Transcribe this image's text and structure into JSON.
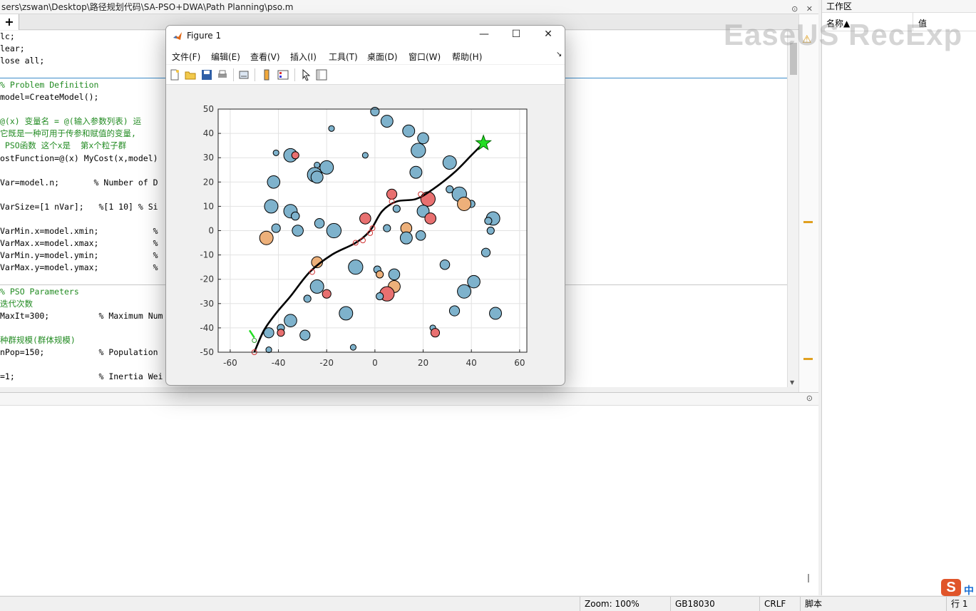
{
  "editor": {
    "path": "sers\\zswan\\Desktop\\路径规划代码\\SA-PSO+DWA\\Path Planning\\pso.m",
    "tab_plus": "+",
    "lines": [
      {
        "text": "lc;",
        "cls": ""
      },
      {
        "text": "lear;",
        "cls": ""
      },
      {
        "text": "lose all;",
        "cls": ""
      },
      {
        "text": "",
        "cls": ""
      },
      {
        "text": "% Problem Definition",
        "cls": "comment"
      },
      {
        "text": "model=CreateModel();",
        "cls": ""
      },
      {
        "text": "",
        "cls": ""
      },
      {
        "text": "@(x) 变量名 = @(输入参数列表) 运",
        "cls": "comment"
      },
      {
        "text": "它既是一种可用于传参和赋值的变量,",
        "cls": "comment"
      },
      {
        "text": " PSO函数 这个x是  第x个粒子群",
        "cls": "comment"
      },
      {
        "text": "ostFunction=@(x) MyCost(x,model)",
        "cls": ""
      },
      {
        "text": "",
        "cls": ""
      },
      {
        "text": "Var=model.n;       % Number of D",
        "cls": ""
      },
      {
        "text": "",
        "cls": ""
      },
      {
        "text": "VarSize=[1 nVar];   %[1 10] % Si",
        "cls": ""
      },
      {
        "text": "",
        "cls": ""
      },
      {
        "text": "VarMin.x=model.xmin;           %",
        "cls": ""
      },
      {
        "text": "VarMax.x=model.xmax;           %",
        "cls": ""
      },
      {
        "text": "VarMin.y=model.ymin;           %",
        "cls": ""
      },
      {
        "text": "VarMax.y=model.ymax;           %",
        "cls": ""
      },
      {
        "text": "",
        "cls": ""
      },
      {
        "text": "% PSO Parameters",
        "cls": "comment"
      },
      {
        "text": "迭代次数",
        "cls": "comment"
      },
      {
        "text": "MaxIt=300;          % Maximum Num",
        "cls": ""
      },
      {
        "text": "",
        "cls": ""
      },
      {
        "text": "种群规模(群体规模)",
        "cls": "comment"
      },
      {
        "text": "nPop=150;           % Population",
        "cls": ""
      },
      {
        "text": "",
        "cls": ""
      },
      {
        "text": "=1;                 % Inertia Wei",
        "cls": ""
      }
    ]
  },
  "workspace": {
    "title": "工作区",
    "col_name": "名称▲",
    "col_value": "值"
  },
  "watermark": "EaseUS RecExp",
  "statusbar": {
    "zoom": "Zoom: 100%",
    "encoding": "GB18030",
    "eol": "CRLF",
    "type": "脚本",
    "pos": "行  1"
  },
  "ime": {
    "logo": "S",
    "lang": "中"
  },
  "figure": {
    "title": "Figure 1",
    "menus": [
      "文件(F)",
      "编辑(E)",
      "查看(V)",
      "插入(I)",
      "工具(T)",
      "桌面(D)",
      "窗口(W)",
      "帮助(H)"
    ],
    "menu_arrow": "↘",
    "controls": {
      "minimize": "—",
      "maximize": "☐",
      "close": "✕"
    }
  },
  "chart_data": {
    "type": "scatter",
    "title": "",
    "xlabel": "",
    "ylabel": "",
    "xlim": [
      -65,
      63
    ],
    "ylim": [
      -50,
      50
    ],
    "xticks": [
      -60,
      -40,
      -20,
      0,
      20,
      40,
      60
    ],
    "yticks": [
      -50,
      -40,
      -30,
      -20,
      -10,
      0,
      10,
      20,
      30,
      40,
      50
    ],
    "grid": true,
    "colors": {
      "obstacle_blue": "#7eb2cc",
      "obstacle_red": "#e87070",
      "obstacle_orange": "#edb07a",
      "path": "#000000",
      "waypoint": "#d03030",
      "goal": "#22dd22"
    },
    "obstacles": [
      {
        "x": 0,
        "y": 49,
        "r": 1.8,
        "c": "blue"
      },
      {
        "x": 5,
        "y": 45,
        "r": 2.5,
        "c": "blue"
      },
      {
        "x": -18,
        "y": 42,
        "r": 1.2,
        "c": "blue"
      },
      {
        "x": 14,
        "y": 41,
        "r": 2.5,
        "c": "blue"
      },
      {
        "x": 20,
        "y": 38,
        "r": 2.3,
        "c": "blue"
      },
      {
        "x": -41,
        "y": 32,
        "r": 1.2,
        "c": "blue"
      },
      {
        "x": -35,
        "y": 31,
        "r": 2.8,
        "c": "blue"
      },
      {
        "x": -33,
        "y": 31,
        "r": 1.5,
        "c": "red"
      },
      {
        "x": -4,
        "y": 31,
        "r": 1.2,
        "c": "blue"
      },
      {
        "x": 18,
        "y": 33,
        "r": 3.0,
        "c": "blue"
      },
      {
        "x": 31,
        "y": 28,
        "r": 2.8,
        "c": "blue"
      },
      {
        "x": -24,
        "y": 27,
        "r": 1.2,
        "c": "blue"
      },
      {
        "x": -20,
        "y": 26,
        "r": 2.8,
        "c": "blue"
      },
      {
        "x": -25,
        "y": 23,
        "r": 3.0,
        "c": "blue"
      },
      {
        "x": -24,
        "y": 22,
        "r": 2.5,
        "c": "blue"
      },
      {
        "x": 17,
        "y": 24,
        "r": 2.5,
        "c": "blue"
      },
      {
        "x": -42,
        "y": 20,
        "r": 2.6,
        "c": "blue"
      },
      {
        "x": 31,
        "y": 17,
        "r": 1.5,
        "c": "blue"
      },
      {
        "x": 35,
        "y": 15,
        "r": 3.0,
        "c": "blue"
      },
      {
        "x": 7,
        "y": 15,
        "r": 2.1,
        "c": "red"
      },
      {
        "x": 22,
        "y": 13,
        "r": 3.0,
        "c": "red"
      },
      {
        "x": 40,
        "y": 11,
        "r": 1.5,
        "c": "blue"
      },
      {
        "x": 37,
        "y": 11,
        "r": 2.8,
        "c": "orange"
      },
      {
        "x": -43,
        "y": 10,
        "r": 2.8,
        "c": "blue"
      },
      {
        "x": -35,
        "y": 8,
        "r": 2.8,
        "c": "blue"
      },
      {
        "x": 9,
        "y": 9,
        "r": 1.5,
        "c": "blue"
      },
      {
        "x": 20,
        "y": 8,
        "r": 2.5,
        "c": "blue"
      },
      {
        "x": -33,
        "y": 6,
        "r": 1.7,
        "c": "blue"
      },
      {
        "x": -4,
        "y": 5,
        "r": 2.3,
        "c": "red"
      },
      {
        "x": 23,
        "y": 5,
        "r": 2.3,
        "c": "red"
      },
      {
        "x": 49,
        "y": 5,
        "r": 2.8,
        "c": "blue"
      },
      {
        "x": 47,
        "y": 4,
        "r": 1.5,
        "c": "blue"
      },
      {
        "x": -23,
        "y": 3,
        "r": 2.0,
        "c": "blue"
      },
      {
        "x": 5,
        "y": 1,
        "r": 1.5,
        "c": "blue"
      },
      {
        "x": 13,
        "y": 1,
        "r": 2.3,
        "c": "orange"
      },
      {
        "x": -41,
        "y": 1,
        "r": 1.8,
        "c": "blue"
      },
      {
        "x": -32,
        "y": 0,
        "r": 2.3,
        "c": "blue"
      },
      {
        "x": -17,
        "y": 0,
        "r": 3.0,
        "c": "blue"
      },
      {
        "x": 48,
        "y": 0,
        "r": 1.5,
        "c": "blue"
      },
      {
        "x": 19,
        "y": -2,
        "r": 2.0,
        "c": "blue"
      },
      {
        "x": 13,
        "y": -3,
        "r": 2.5,
        "c": "blue"
      },
      {
        "x": -45,
        "y": -3,
        "r": 2.8,
        "c": "orange"
      },
      {
        "x": 46,
        "y": -9,
        "r": 1.8,
        "c": "blue"
      },
      {
        "x": -24,
        "y": -13,
        "r": 2.3,
        "c": "orange"
      },
      {
        "x": 29,
        "y": -14,
        "r": 2.0,
        "c": "blue"
      },
      {
        "x": -8,
        "y": -15,
        "r": 3.0,
        "c": "blue"
      },
      {
        "x": 1,
        "y": -16,
        "r": 1.5,
        "c": "blue"
      },
      {
        "x": 8,
        "y": -18,
        "r": 2.3,
        "c": "blue"
      },
      {
        "x": 2,
        "y": -18,
        "r": 1.5,
        "c": "orange"
      },
      {
        "x": 41,
        "y": -21,
        "r": 2.6,
        "c": "blue"
      },
      {
        "x": 8,
        "y": -23,
        "r": 2.5,
        "c": "orange"
      },
      {
        "x": -24,
        "y": -23,
        "r": 2.8,
        "c": "blue"
      },
      {
        "x": 37,
        "y": -25,
        "r": 2.8,
        "c": "blue"
      },
      {
        "x": -20,
        "y": -26,
        "r": 1.8,
        "c": "red"
      },
      {
        "x": 5,
        "y": -26,
        "r": 3.0,
        "c": "red"
      },
      {
        "x": 2,
        "y": -27,
        "r": 1.5,
        "c": "blue"
      },
      {
        "x": -28,
        "y": -28,
        "r": 1.5,
        "c": "blue"
      },
      {
        "x": 33,
        "y": -33,
        "r": 2.1,
        "c": "blue"
      },
      {
        "x": 50,
        "y": -34,
        "r": 2.5,
        "c": "blue"
      },
      {
        "x": -12,
        "y": -34,
        "r": 2.8,
        "c": "blue"
      },
      {
        "x": -35,
        "y": -37,
        "r": 2.6,
        "c": "blue"
      },
      {
        "x": -39,
        "y": -40,
        "r": 1.5,
        "c": "blue"
      },
      {
        "x": 24,
        "y": -40,
        "r": 1.2,
        "c": "blue"
      },
      {
        "x": -44,
        "y": -42,
        "r": 2.1,
        "c": "blue"
      },
      {
        "x": -39,
        "y": -42,
        "r": 1.5,
        "c": "red"
      },
      {
        "x": 25,
        "y": -42,
        "r": 1.8,
        "c": "red"
      },
      {
        "x": -29,
        "y": -43,
        "r": 2.1,
        "c": "blue"
      },
      {
        "x": -9,
        "y": -48,
        "r": 1.2,
        "c": "blue"
      },
      {
        "x": -44,
        "y": -49,
        "r": 1.2,
        "c": "blue"
      }
    ],
    "path": [
      [
        -50,
        -50
      ],
      [
        -46,
        -41
      ],
      [
        -41,
        -34
      ],
      [
        -35,
        -27
      ],
      [
        -27,
        -17
      ],
      [
        -18,
        -10
      ],
      [
        -8,
        -5
      ],
      [
        -2,
        0
      ],
      [
        3,
        8
      ],
      [
        9,
        12
      ],
      [
        17,
        13
      ],
      [
        24,
        17
      ],
      [
        33,
        24
      ],
      [
        40,
        31
      ],
      [
        45,
        36
      ]
    ],
    "waypoints": [
      [
        -50,
        -50
      ],
      [
        -26,
        -17
      ],
      [
        -8,
        -5
      ],
      [
        -5,
        -4
      ],
      [
        -2,
        -1
      ],
      [
        -1,
        1
      ],
      [
        7,
        12
      ],
      [
        19,
        15
      ]
    ],
    "start": [
      -50,
      -50
    ],
    "goal": [
      45,
      36
    ],
    "start_heading_marker": {
      "from": [
        -52,
        -41
      ],
      "to": [
        -50,
        -44
      ]
    }
  }
}
